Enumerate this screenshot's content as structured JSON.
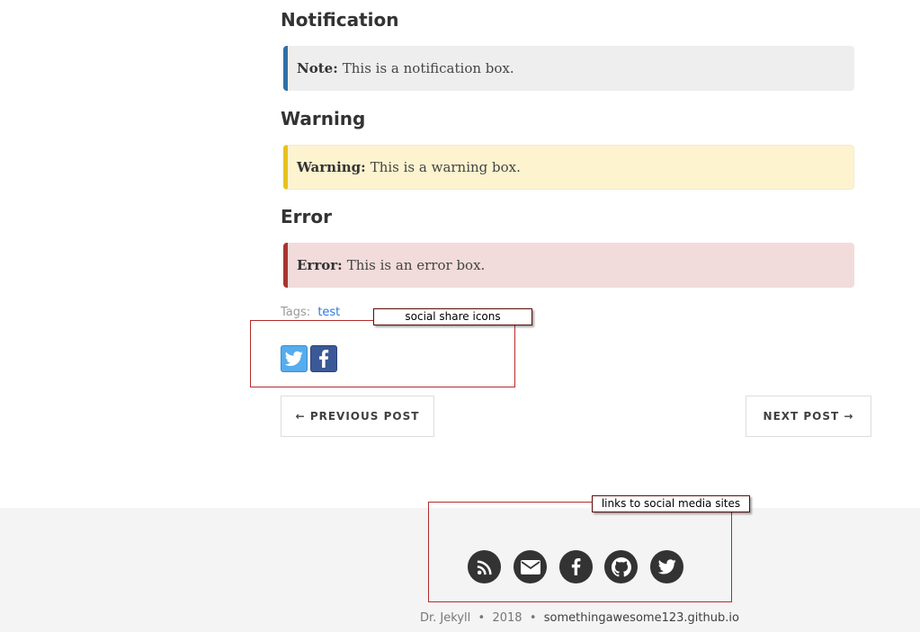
{
  "sections": {
    "notification": {
      "heading": "Notification",
      "label": "Note:",
      "text": "This is a notification box."
    },
    "warning": {
      "heading": "Warning",
      "label": "Warning:",
      "text": "This is a warning box."
    },
    "error": {
      "heading": "Error",
      "label": "Error:",
      "text": "This is an error box."
    }
  },
  "tags": {
    "label": "Tags:",
    "items": [
      "test"
    ]
  },
  "annotations": {
    "share": "social share icons",
    "social": "links to social media sites"
  },
  "share_icons": [
    "twitter-icon",
    "facebook-icon"
  ],
  "pager": {
    "previous": "← PREVIOUS POST",
    "next": "NEXT POST →"
  },
  "footer": {
    "social_icons": [
      "rss-icon",
      "email-icon",
      "facebook-icon",
      "github-icon",
      "twitter-icon"
    ],
    "author": "Dr. Jekyll",
    "separator": "•",
    "year": "2018",
    "site": "somethingawesome123.github.io"
  },
  "colors": {
    "note_accent": "#2f6fa7",
    "warning_accent": "#e7c21e",
    "error_accent": "#a8342f",
    "link": "#2a7ae2",
    "twitter": "#55acee",
    "facebook": "#3b5998"
  }
}
